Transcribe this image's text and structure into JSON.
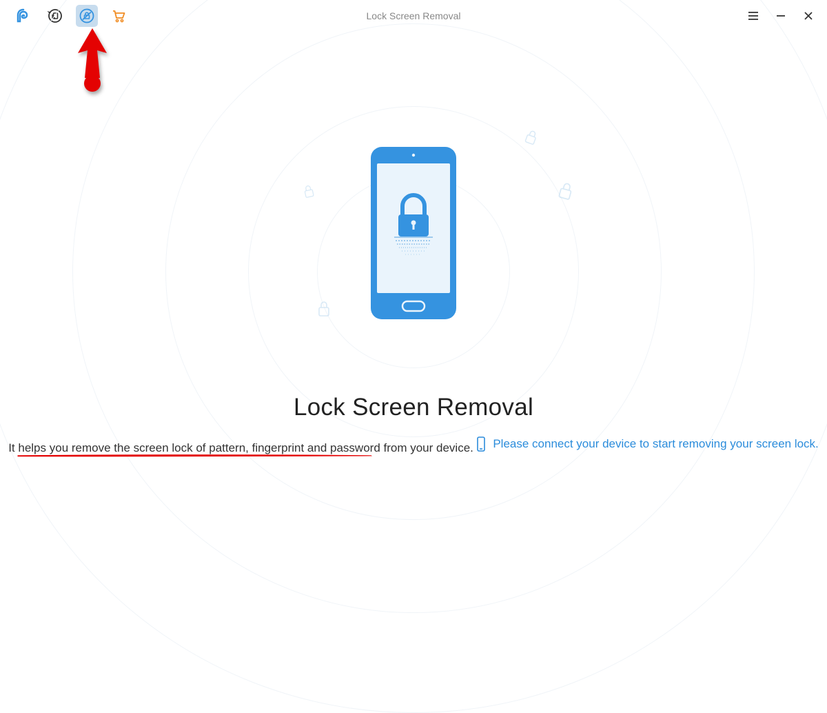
{
  "header": {
    "title": "Lock Screen Removal"
  },
  "main": {
    "title": "Lock Screen Removal",
    "subtitle": "It helps you remove the screen lock of pattern, fingerprint and password from your device.",
    "connect_prompt": "Please connect your device to start removing your screen lock."
  },
  "colors": {
    "primary_blue": "#3593e0",
    "light_blue": "#7cb7e6",
    "orange": "#f08c22",
    "red": "#e40202",
    "text_gray": "#888"
  },
  "icons": {
    "logo": "logo",
    "recovery": "recovery",
    "lock_screen": "lock-screen",
    "cart": "cart",
    "menu": "menu",
    "minimize": "minimize",
    "close": "close"
  }
}
